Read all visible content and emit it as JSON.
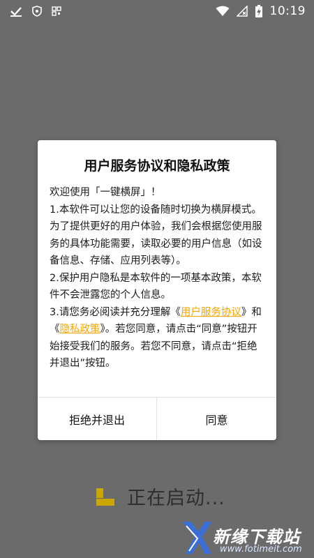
{
  "status_bar": {
    "time": "10:19",
    "left_icons": [
      "checkmark-notification-icon",
      "shield-icon",
      "qr-icon"
    ],
    "right_icons": [
      "wifi-icon",
      "no-sim-icon",
      "battery-charging-icon"
    ]
  },
  "dialog": {
    "title": "用户服务协议和隐私政策",
    "line1": "欢迎使用「一键横屏」！",
    "para1": "1.本软件可以让您的设备随时切换为横屏模式。为了提供更好的用户体验，我们会根据您使用服务的具体功能需要，读取必要的用户信息（如设备信息、存储、应用列表等）。",
    "para2": "2.保护用户隐私是本软件的一项基本政策，本软件不会泄露您的个人信息。",
    "para3_prefix": "3.请您务必阅读并充分理解《",
    "link_service": "用户服务协议",
    "para3_mid": "》和《",
    "link_privacy": "隐私政策",
    "para3_suffix": "》。若您同意，请点击“同意”按钮开始接受我们的服务。若您不同意，请点击“拒绝并退出”按钮。",
    "reject_label": "拒绝并退出",
    "agree_label": "同意"
  },
  "launch": {
    "text": "正在启动..."
  },
  "watermark": {
    "text": "新缘下载站",
    "url": "www.fotimeit.com"
  },
  "colors": {
    "overlay": "#6b6b6b",
    "link": "#f5a700",
    "launch_icon": "#c9a600"
  }
}
